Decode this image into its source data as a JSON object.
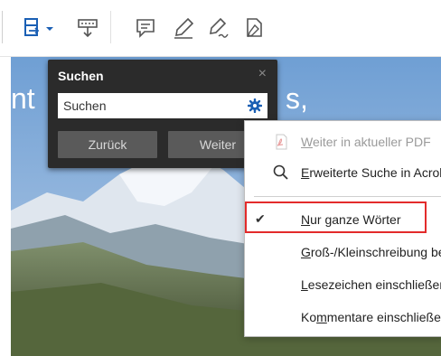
{
  "toolbar": {
    "icons": [
      "crop-page-icon",
      "dropdown-arrow-icon",
      "stamp-icon",
      "comment-icon",
      "highlight-pen-icon",
      "signature-icon",
      "fill-sign-icon"
    ]
  },
  "document": {
    "text_left": "nt",
    "text_right": "s,"
  },
  "search_panel": {
    "title": "Suchen",
    "close_label": "×",
    "input_value": "Suchen",
    "back_label": "Zurück",
    "next_label": "Weiter"
  },
  "menu": {
    "items": [
      {
        "label": "Weiter in aktueller PDF",
        "accel": "W",
        "rest": "eiter in aktueller PDF",
        "enabled": false,
        "icon": "pdf-icon"
      },
      {
        "label": "Erweiterte Suche in Acrobat",
        "accel": "E",
        "rest": "rweiterte Suche in Acrobat",
        "enabled": true,
        "icon": "magnifier-icon"
      },
      {
        "label": "Nur ganze Wörter",
        "accel": "N",
        "rest": "ur ganze Wörter",
        "enabled": true,
        "checked": true
      },
      {
        "label": "Groß-/Kleinschreibung beachten",
        "prefix": "",
        "accel": "G",
        "rest": "roß-/Kleinschreibung beachten",
        "enabled": true
      },
      {
        "label": "Lesezeichen einschließen",
        "accel": "L",
        "rest": "esezeichen einschließen",
        "enabled": true
      },
      {
        "label": "Kommentare einschließen",
        "prefix": "Ko",
        "accel": "m",
        "rest": "mentare einschließen",
        "enabled": true
      }
    ],
    "check_glyph": "✔"
  },
  "colors": {
    "toolbar_icon": "#1a5fb4",
    "panel_bg": "#2b2b2b",
    "gear": "#1a5fb4",
    "highlight": "#e32b2b"
  }
}
